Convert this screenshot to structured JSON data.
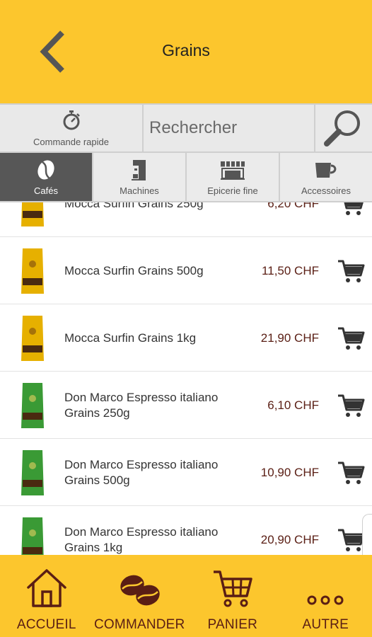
{
  "header": {
    "title": "Grains"
  },
  "toolbar": {
    "quick_order_label": "Commande rapide",
    "search_placeholder": "Rechercher"
  },
  "categories": [
    {
      "label": "Cafés",
      "active": true,
      "icon": "coffee-bean-icon"
    },
    {
      "label": "Machines",
      "active": false,
      "icon": "espresso-machine-icon"
    },
    {
      "label": "Epicerie fine",
      "active": false,
      "icon": "shop-icon"
    },
    {
      "label": "Accessoires",
      "active": false,
      "icon": "cup-icon"
    }
  ],
  "products": [
    {
      "name": "Mocca Surfin Grains 250g",
      "price": "6,20 CHF",
      "package_color": "#e6b000"
    },
    {
      "name": "Mocca Surfin Grains 500g",
      "price": "11,50 CHF",
      "package_color": "#e6b000"
    },
    {
      "name": "Mocca Surfin Grains 1kg",
      "price": "21,90 CHF",
      "package_color": "#e6b000"
    },
    {
      "name": "Don Marco Espresso italiano Grains 250g",
      "price": "6,10 CHF",
      "package_color": "#3a9a35"
    },
    {
      "name": "Don Marco Espresso italiano Grains 500g",
      "price": "10,90 CHF",
      "package_color": "#3a9a35"
    },
    {
      "name": "Don Marco Espresso italiano Grains 1kg",
      "price": "20,90 CHF",
      "package_color": "#3a9a35"
    }
  ],
  "nav": [
    {
      "label": "ACCUEIL",
      "icon": "home-icon"
    },
    {
      "label": "COMMANDER",
      "icon": "coffee-beans-icon"
    },
    {
      "label": "PANIER",
      "icon": "cart-icon"
    },
    {
      "label": "AUTRE",
      "icon": "more-icon"
    }
  ],
  "colors": {
    "brand_yellow": "#fcc62d",
    "brand_brown": "#5a1e14",
    "active_tab": "#575757"
  }
}
